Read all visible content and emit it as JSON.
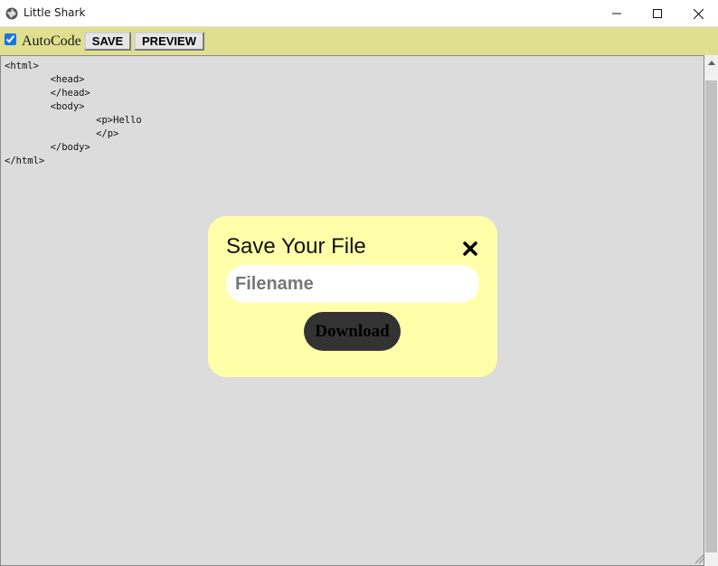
{
  "window": {
    "title": "Little Shark",
    "icon": "globe-icon",
    "controls": [
      "minimize-icon",
      "maximize-icon",
      "close-icon"
    ]
  },
  "toolbar": {
    "autocode_label": "AutoCode",
    "autocode_checked": true,
    "save_label": "SAVE",
    "preview_label": "PREVIEW",
    "background": "#dfdf8f"
  },
  "editor": {
    "code": "<html>\n\t<head>\n\t</head>\n\t<body>\n\t\t<p>Hello\n\t\t</p>\n\t</body>\n</html>",
    "background": "#dcdcdc"
  },
  "modal": {
    "title": "Save Your File",
    "close_icon": "close-x-icon",
    "filename_placeholder": "Filename",
    "filename_value": "",
    "download_label": "Download",
    "background": "#ffffaa",
    "button_color": "#333333"
  }
}
